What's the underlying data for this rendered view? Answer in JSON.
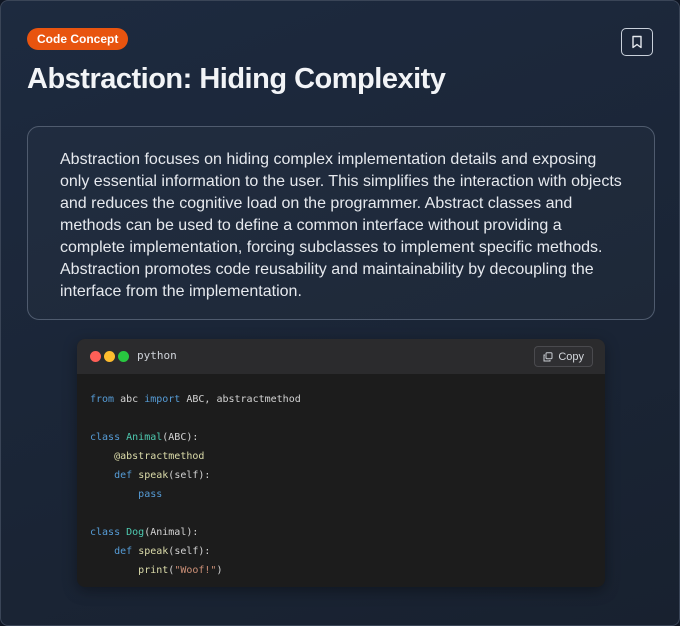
{
  "badge": "Code Concept",
  "title": "Abstraction: Hiding Complexity",
  "description": "Abstraction focuses on hiding complex implementation details and exposing only essential information to the user. This simplifies the interaction with objects and reduces the cognitive load on the programmer. Abstract classes and methods can be used to define a common interface without providing a complete implementation, forcing subclasses to implement specific methods. Abstraction promotes code reusability and maintainability by decoupling the interface from the implementation.",
  "code": {
    "language": "python",
    "copy_label": "Copy",
    "lines": [
      [
        [
          "kw",
          "from"
        ],
        [
          "t",
          " abc "
        ],
        [
          "kw",
          "import"
        ],
        [
          "t",
          " ABC, abstractmethod"
        ]
      ],
      [],
      [
        [
          "kw",
          "class"
        ],
        [
          "t",
          " "
        ],
        [
          "cls",
          "Animal"
        ],
        [
          "t",
          "(ABC):"
        ]
      ],
      [
        [
          "t",
          "    "
        ],
        [
          "dec",
          "@abstractmethod"
        ]
      ],
      [
        [
          "t",
          "    "
        ],
        [
          "kw",
          "def"
        ],
        [
          "t",
          " "
        ],
        [
          "fn",
          "speak"
        ],
        [
          "t",
          "(self):"
        ]
      ],
      [
        [
          "t",
          "        "
        ],
        [
          "kw",
          "pass"
        ]
      ],
      [],
      [
        [
          "kw",
          "class"
        ],
        [
          "t",
          " "
        ],
        [
          "cls",
          "Dog"
        ],
        [
          "t",
          "(Animal):"
        ]
      ],
      [
        [
          "t",
          "    "
        ],
        [
          "kw",
          "def"
        ],
        [
          "t",
          " "
        ],
        [
          "fn",
          "speak"
        ],
        [
          "t",
          "(self):"
        ]
      ],
      [
        [
          "t",
          "        "
        ],
        [
          "fn",
          "print"
        ],
        [
          "t",
          "("
        ],
        [
          "str",
          "\"Woof!\""
        ],
        [
          "t",
          ")"
        ]
      ]
    ]
  },
  "icons": {
    "bookmark": "bookmark-icon",
    "copy": "copy-icon"
  },
  "colors": {
    "badge_bg": "#e8540f",
    "background": "#1b2638",
    "code_bg": "#1c1c1c"
  }
}
